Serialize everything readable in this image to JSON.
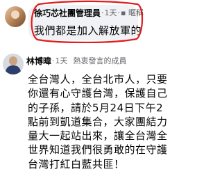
{
  "comment1": {
    "author": "徐巧芯社團管理員",
    "dot": "·",
    "time": "1天",
    "menu_dot": "·",
    "reply": "▪ 暱稱",
    "text": "我們都是加入解放軍的"
  },
  "comment2": {
    "author": "林博暐",
    "dot": "·",
    "time": "1天",
    "badge": "熱衷發言的成員",
    "lines": [
      "全台灣人，全台北市人，只要",
      "你還有心守護台灣，保護自己",
      "的子孫，請於5月24日下午2",
      "點前到凱道集合，大家團結力",
      "量大一起站出來，讓全台灣全",
      "世界知道我們很勇敢的在守護",
      "台灣打紅白藍共匪！"
    ]
  },
  "colors": {
    "annotation_circle": "#e21b1b",
    "bubble": "#f0f2f5",
    "meta_text": "#65676b"
  }
}
